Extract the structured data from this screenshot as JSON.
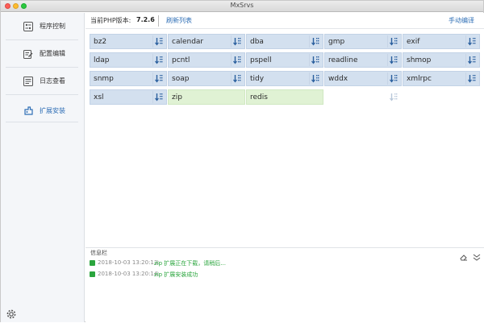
{
  "window": {
    "title": "MxSrvs"
  },
  "sidebar": {
    "items": [
      {
        "label": "程序控制",
        "icon": "program-control-icon"
      },
      {
        "label": "配置编辑",
        "icon": "config-edit-icon"
      },
      {
        "label": "日志查看",
        "icon": "log-view-icon"
      },
      {
        "label": "扩展安装",
        "icon": "extension-install-icon",
        "active": true
      }
    ],
    "settings_icon": "gear-icon"
  },
  "header": {
    "php_label": "当前PHP版本:",
    "php_version": "7.2.6",
    "refresh_label": "刷新列表",
    "compile_label": "手动编译"
  },
  "extensions": [
    {
      "name": "bz2",
      "status": "available"
    },
    {
      "name": "calendar",
      "status": "available"
    },
    {
      "name": "dba",
      "status": "available"
    },
    {
      "name": "gmp",
      "status": "available"
    },
    {
      "name": "exif",
      "status": "available"
    },
    {
      "name": "ldap",
      "status": "available"
    },
    {
      "name": "pcntl",
      "status": "available"
    },
    {
      "name": "pspell",
      "status": "available"
    },
    {
      "name": "readline",
      "status": "available"
    },
    {
      "name": "shmop",
      "status": "available"
    },
    {
      "name": "snmp",
      "status": "available"
    },
    {
      "name": "soap",
      "status": "available"
    },
    {
      "name": "tidy",
      "status": "available"
    },
    {
      "name": "wddx",
      "status": "available"
    },
    {
      "name": "xmlrpc",
      "status": "available"
    },
    {
      "name": "xsl",
      "status": "available"
    },
    {
      "name": "zip",
      "status": "installed"
    },
    {
      "name": "redis",
      "status": "installed"
    },
    {
      "name": "",
      "status": "loading"
    }
  ],
  "info_panel": {
    "title": "信息栏",
    "logs": [
      {
        "time": "2018-10-03 13:20:13:",
        "message": "zip 扩展正在下载，请稍后..."
      },
      {
        "time": "2018-10-03 13:20:14:",
        "message": "zip 扩展安装成功"
      }
    ]
  },
  "colors": {
    "tile_available": "#d3e0ef",
    "tile_installed": "#e0f2d4",
    "accent": "#2f6fb6",
    "success": "#2aa53d"
  }
}
